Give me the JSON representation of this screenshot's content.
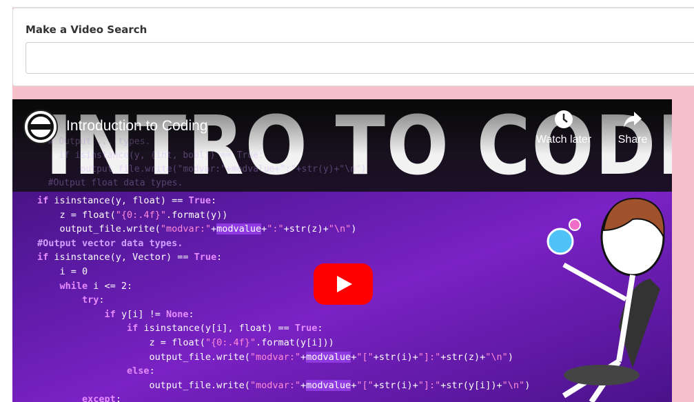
{
  "search": {
    "label": "Make a Video Search",
    "value": "",
    "placeholder": ""
  },
  "video": {
    "title": "Introduction to Coding",
    "thumbnail_title": "INTRO TO CODING",
    "watch_later_label": "Watch later",
    "share_label": "Share",
    "icons": {
      "channel": "channel-logo",
      "watch_later": "clock-icon",
      "share": "share-arrow-icon",
      "play": "youtube-play-icon"
    },
    "colors": {
      "play_button": "#ff0000",
      "background_accent": "#6b1fb8",
      "page_background": "#f6c1cb"
    }
  }
}
